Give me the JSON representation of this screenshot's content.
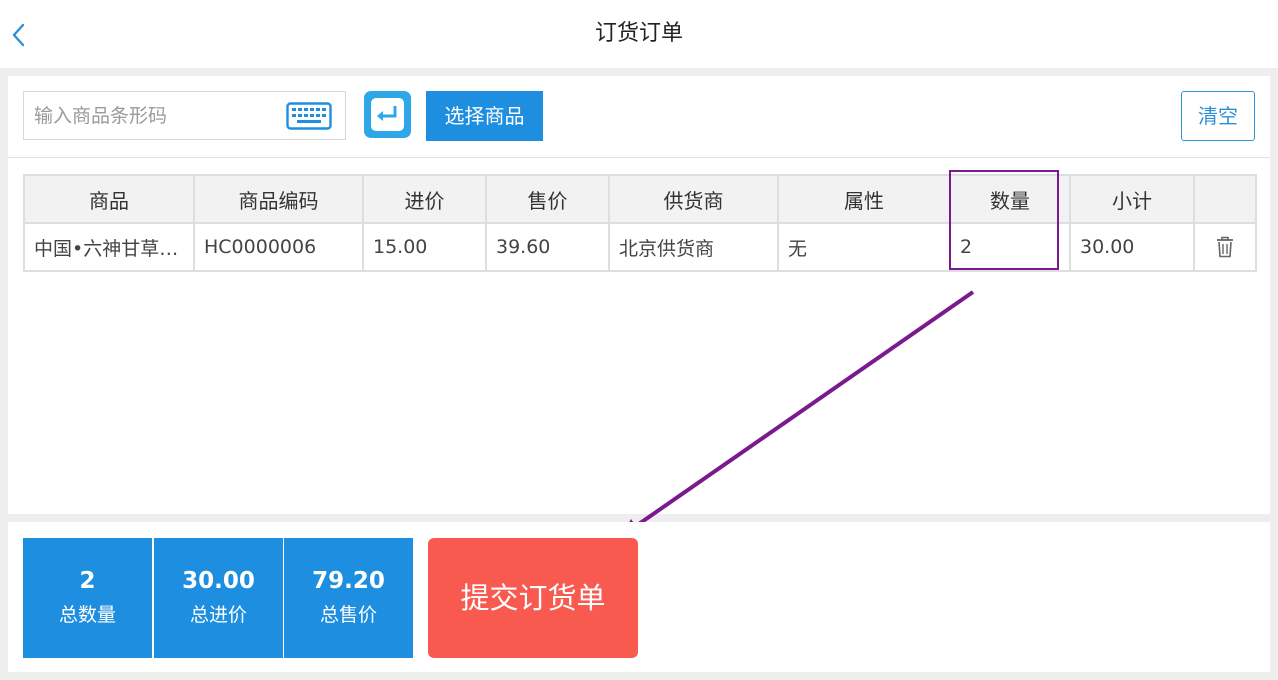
{
  "header": {
    "title": "订货订单",
    "back_icon": "chevron-left-icon"
  },
  "toolbar": {
    "search_placeholder": "输入商品条形码",
    "search_value": "",
    "keyboard_icon": "keyboard-icon",
    "enter_icon": "enter-return-icon",
    "select_label": "选择商品",
    "clear_label": "清空"
  },
  "table": {
    "columns": [
      "商品",
      "商品编码",
      "进价",
      "售价",
      "供货商",
      "属性",
      "数量",
      "小计",
      ""
    ],
    "rows": [
      {
        "name": "中国•六神甘草…",
        "code": "HC0000006",
        "cost": "15.00",
        "price": "39.60",
        "supplier": "北京供货商",
        "attribute": "无",
        "quantity": "2",
        "subtotal": "30.00",
        "action_icon": "trash-icon"
      }
    ]
  },
  "summary": {
    "total_quantity": {
      "value": "2",
      "label": "总数量"
    },
    "total_cost": {
      "value": "30.00",
      "label": "总进价"
    },
    "total_price": {
      "value": "79.20",
      "label": "总售价"
    }
  },
  "submit_label": "提交订货单",
  "colors": {
    "primary": "#1e8ee0",
    "submit": "#f85a50",
    "annotation": "#7a1a8e"
  }
}
